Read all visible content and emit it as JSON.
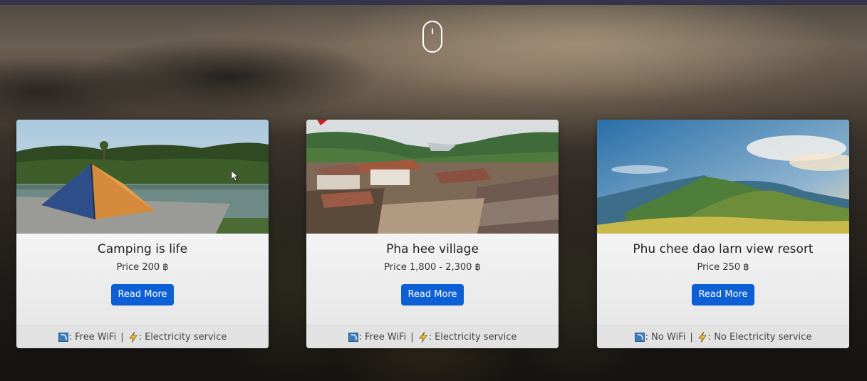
{
  "cards": [
    {
      "title": "Camping is life",
      "price": "Price 200 ฿",
      "button_label": "Read More",
      "wifi_text": ": Free WiFi",
      "separator": "|",
      "electricity_text": ": Electricity service",
      "image": "tent-by-lake"
    },
    {
      "title": "Pha hee village",
      "price": "Price 1,800 - 2,300 ฿",
      "button_label": "Read More",
      "wifi_text": ": Free WiFi",
      "separator": "|",
      "electricity_text": ": Electricity service",
      "image": "hillside-village"
    },
    {
      "title": "Phu chee dao larn view resort",
      "price": "Price 250 ฿",
      "button_label": "Read More",
      "wifi_text": ": No WiFi",
      "separator": "|",
      "electricity_text": ": No Electricity service",
      "image": "mountain-view"
    }
  ],
  "icons": {
    "scroll": "mouse-scroll-icon",
    "wifi": "wifi-icon",
    "electricity": "lightning-bolt-icon"
  },
  "colors": {
    "button": "#0d5fd6",
    "topbar": "#34344a"
  }
}
